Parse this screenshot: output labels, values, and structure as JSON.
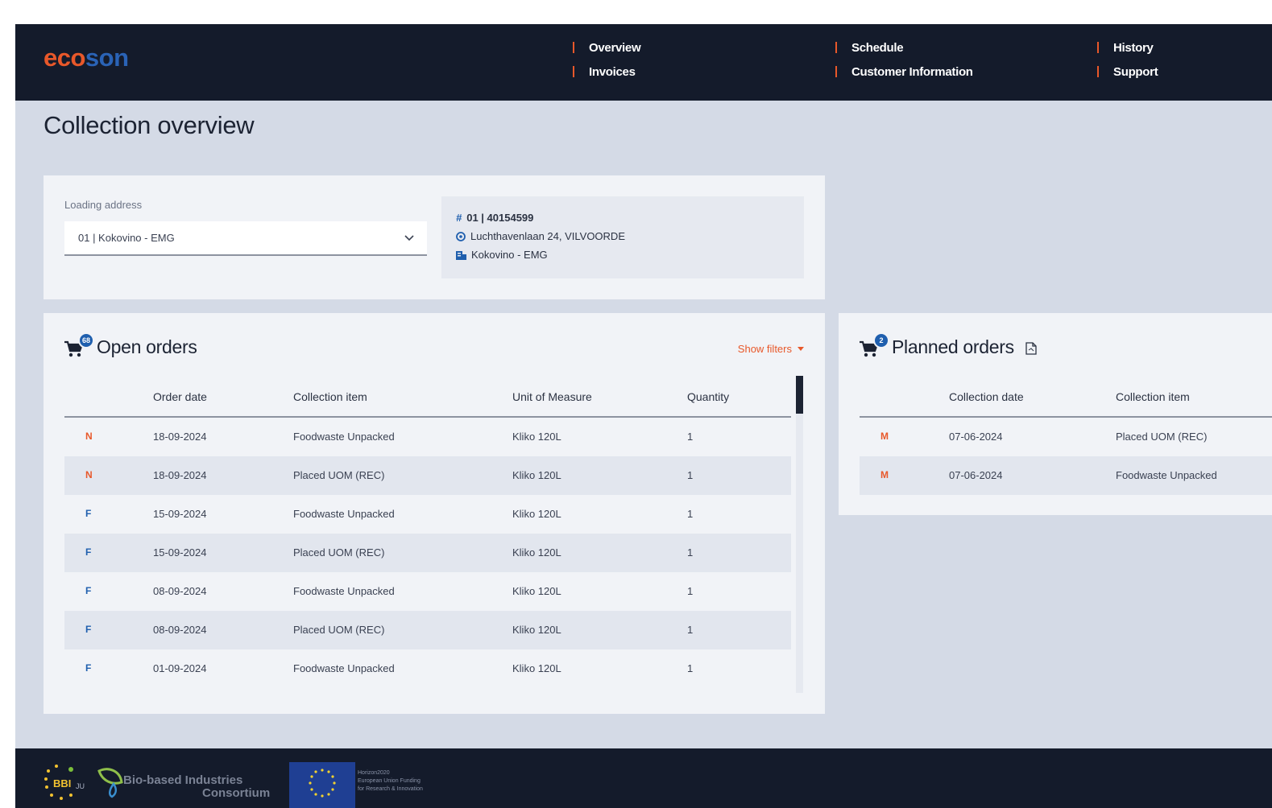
{
  "brand": {
    "part1": "eco",
    "part2": "son"
  },
  "nav": {
    "col1": [
      "Overview",
      "Invoices"
    ],
    "col2": [
      "Schedule",
      "Customer Information"
    ],
    "col3": [
      "History",
      "Support"
    ]
  },
  "page_title": "Collection overview",
  "address": {
    "label": "Loading address",
    "selected": "01 | Kokovino - EMG",
    "id": "01 | 40154599",
    "street": "Luchthavenlaan 24, VILVOORDE",
    "name": "Kokovino - EMG"
  },
  "open_orders": {
    "title": "Open orders",
    "count": "68",
    "show_filters": "Show filters",
    "columns": [
      "Order date",
      "Collection item",
      "Unit of Measure",
      "Quantity"
    ],
    "rows": [
      {
        "status": "N",
        "date": "18-09-2024",
        "item": "Foodwaste Unpacked",
        "uom": "Kliko 120L",
        "qty": "1"
      },
      {
        "status": "N",
        "date": "18-09-2024",
        "item": "Placed UOM (REC)",
        "uom": "Kliko 120L",
        "qty": "1"
      },
      {
        "status": "F",
        "date": "15-09-2024",
        "item": "Foodwaste Unpacked",
        "uom": "Kliko 120L",
        "qty": "1"
      },
      {
        "status": "F",
        "date": "15-09-2024",
        "item": "Placed UOM (REC)",
        "uom": "Kliko 120L",
        "qty": "1"
      },
      {
        "status": "F",
        "date": "08-09-2024",
        "item": "Foodwaste Unpacked",
        "uom": "Kliko 120L",
        "qty": "1"
      },
      {
        "status": "F",
        "date": "08-09-2024",
        "item": "Placed UOM (REC)",
        "uom": "Kliko 120L",
        "qty": "1"
      },
      {
        "status": "F",
        "date": "01-09-2024",
        "item": "Foodwaste Unpacked",
        "uom": "Kliko 120L",
        "qty": "1"
      }
    ]
  },
  "planned_orders": {
    "title": "Planned orders",
    "count": "2",
    "columns": [
      "Collection date",
      "Collection item"
    ],
    "rows": [
      {
        "status": "M",
        "date": "07-06-2024",
        "item": "Placed UOM (REC)"
      },
      {
        "status": "M",
        "date": "07-06-2024",
        "item": "Foodwaste Unpacked"
      }
    ]
  },
  "footer": {
    "bbi": "BBI",
    "bbi_suffix": "JU",
    "bic_line1": "Bio-based Industries",
    "bic_line2": "Consortium",
    "eu_text": [
      "Horizon2020",
      "European Union Funding",
      "for Research & Innovation"
    ]
  },
  "colors": {
    "accent": "#e8582a",
    "brand_blue": "#2a63b6",
    "header_bg": "#141b2b",
    "page_bg": "#d4dae6"
  }
}
